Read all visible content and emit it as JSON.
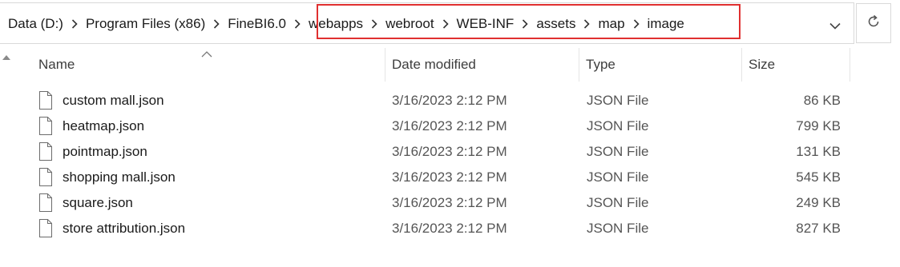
{
  "breadcrumbs": [
    "Data (D:)",
    "Program Files (x86)",
    "FineBI6.0",
    "webapps",
    "webroot",
    "WEB-INF",
    "assets",
    "map",
    "image"
  ],
  "highlight_color": "#e03030",
  "icons": {
    "separator": "chevron-right-icon",
    "dropdown": "chevron-down-icon",
    "refresh": "refresh-icon",
    "file": "file-icon",
    "sort": "sort-up-icon",
    "scroll": "scroll-up-icon"
  },
  "columns": {
    "name": "Name",
    "date": "Date modified",
    "type": "Type",
    "size": "Size"
  },
  "files": [
    {
      "name": "custom mall.json",
      "date": "3/16/2023 2:12 PM",
      "type": "JSON File",
      "size": "86 KB"
    },
    {
      "name": "heatmap.json",
      "date": "3/16/2023 2:12 PM",
      "type": "JSON File",
      "size": "799 KB"
    },
    {
      "name": "pointmap.json",
      "date": "3/16/2023 2:12 PM",
      "type": "JSON File",
      "size": "131 KB"
    },
    {
      "name": "shopping mall.json",
      "date": "3/16/2023 2:12 PM",
      "type": "JSON File",
      "size": "545 KB"
    },
    {
      "name": "square.json",
      "date": "3/16/2023 2:12 PM",
      "type": "JSON File",
      "size": "249 KB"
    },
    {
      "name": "store attribution.json",
      "date": "3/16/2023 2:12 PM",
      "type": "JSON File",
      "size": "827 KB"
    }
  ]
}
